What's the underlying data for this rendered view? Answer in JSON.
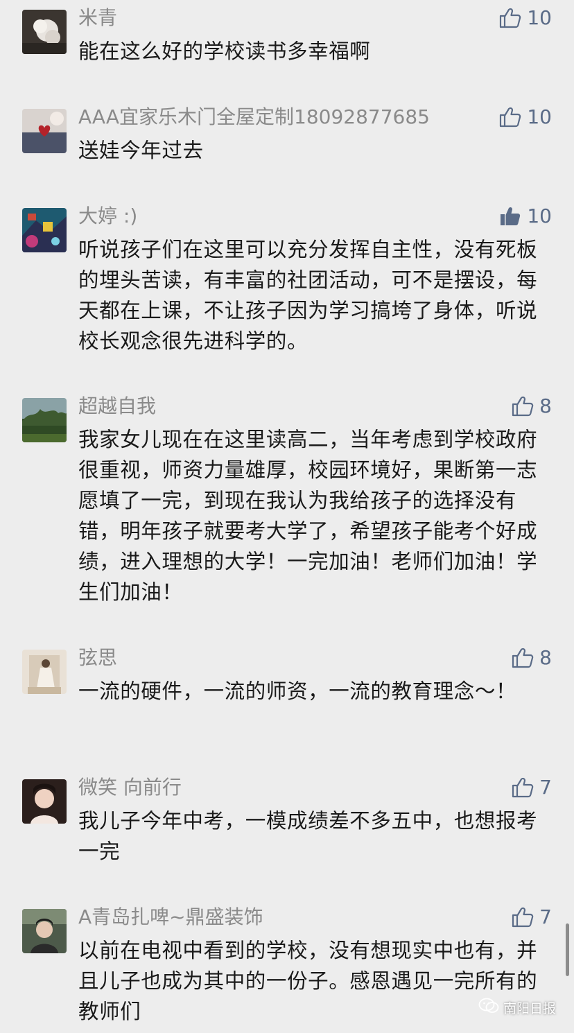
{
  "comments": [
    {
      "user": "米青",
      "likes": "10",
      "liked": false,
      "text": "能在这么好的学校读书多幸福啊"
    },
    {
      "user": "AAA宜家乐木门全屋定制18092877685",
      "likes": "10",
      "liked": false,
      "text": "送娃今年过去"
    },
    {
      "user": "大婷 :)",
      "likes": "10",
      "liked": true,
      "text": "听说孩子们在这里可以充分发挥自主性，没有死板的埋头苦读，有丰富的社团活动，可不是摆设，每天都在上课，不让孩子因为学习搞垮了身体，听说校长观念很先进科学的。"
    },
    {
      "user": "超越自我",
      "likes": "8",
      "liked": false,
      "text": "我家女儿现在在这里读高二，当年考虑到学校政府很重视，师资力量雄厚，校园环境好，果断第一志愿填了一完，到现在我认为我给孩子的选择没有错，明年孩子就要考大学了，希望孩子能考个好成绩，进入理想的大学！一完加油！老师们加油！学生们加油！"
    },
    {
      "user": "弦思",
      "likes": "8",
      "liked": false,
      "text": "一流的硬件，一流的师资，一流的教育理念～！"
    },
    {
      "user": "微笑 向前行",
      "likes": "7",
      "liked": false,
      "text": "我儿子今年中考，一模成绩差不多五中，也想报考一完"
    },
    {
      "user": "A青岛扎啤~鼎盛装饰",
      "likes": "7",
      "liked": false,
      "text": "以前在电视中看到的学校，没有想现实中也有，并且儿子也成为其中的一份子。感恩遇见一完所有的教师们"
    }
  ],
  "watermark": "南阳日报",
  "colors": {
    "background": "#ededed",
    "name": "#8a8a8a",
    "text": "#1a1a1a",
    "like": "#5a6b87"
  }
}
